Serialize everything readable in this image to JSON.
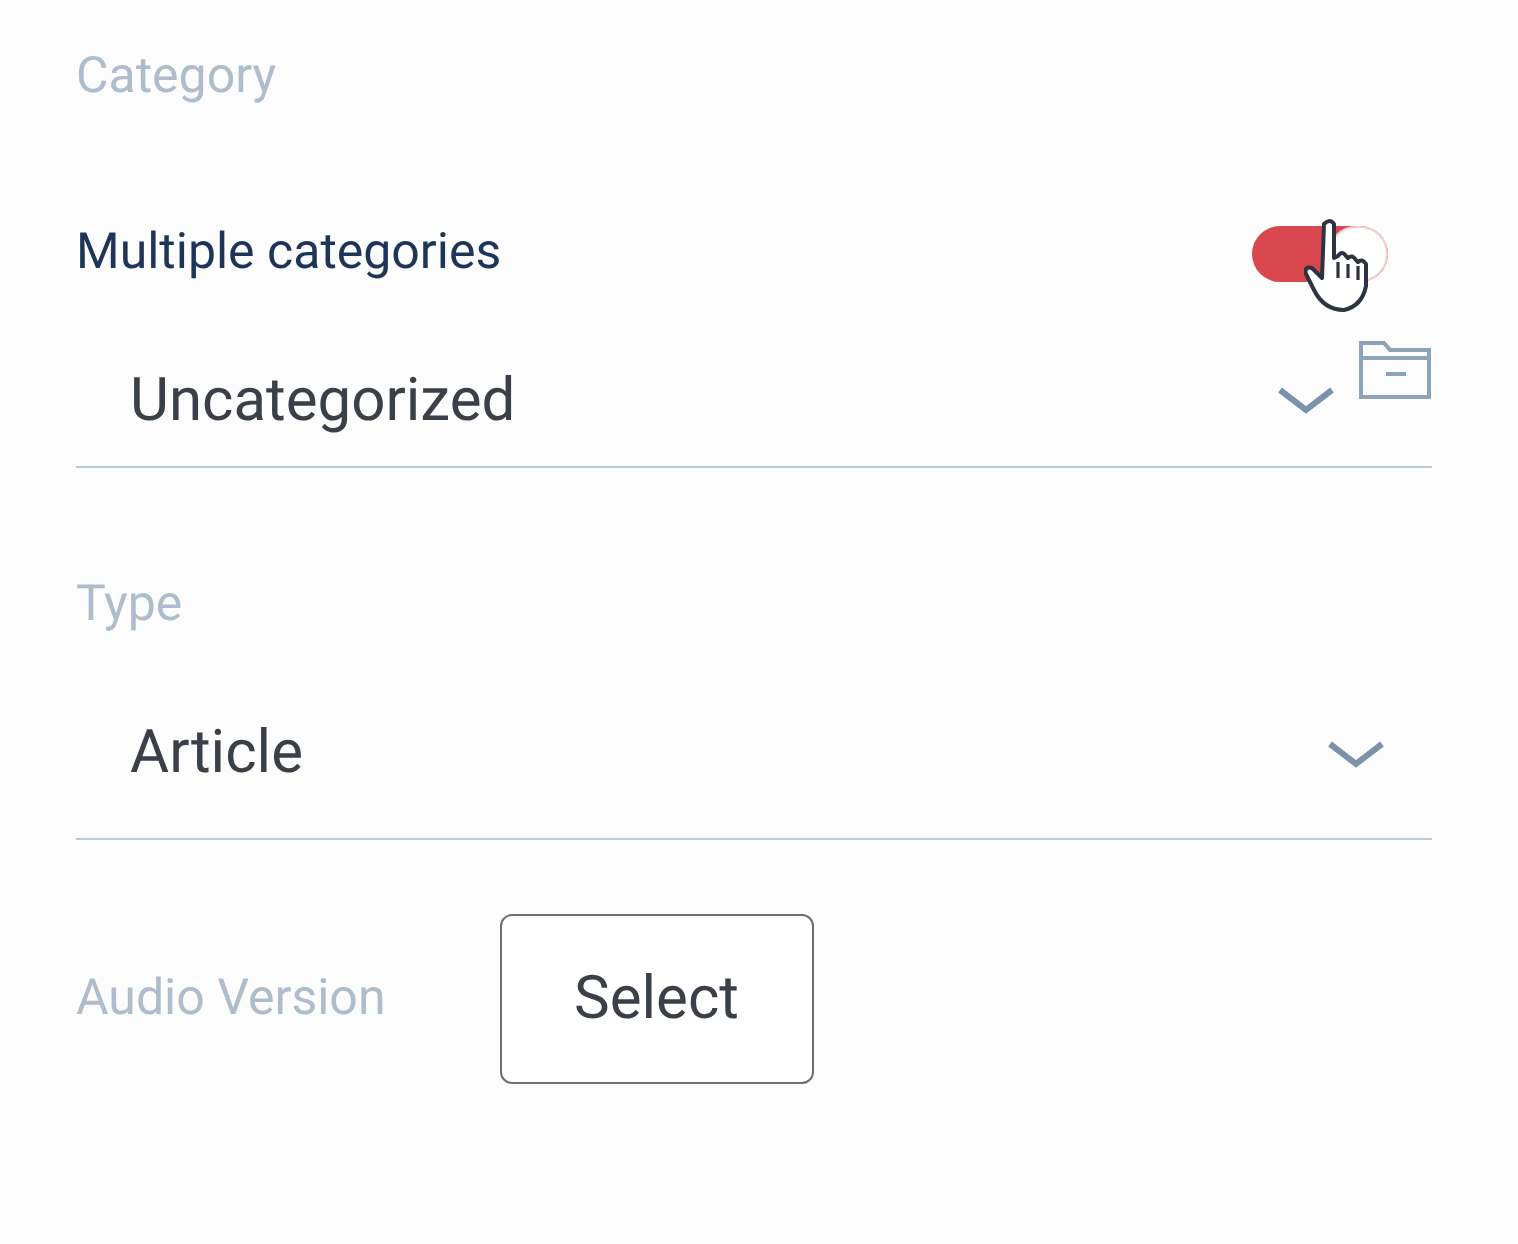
{
  "category": {
    "label": "Category",
    "multiple": {
      "label": "Multiple categories",
      "on": true
    },
    "select": {
      "value": "Uncategorized"
    }
  },
  "type": {
    "label": "Type",
    "select": {
      "value": "Article"
    }
  },
  "audio": {
    "label": "Audio Version",
    "button": "Select"
  }
}
